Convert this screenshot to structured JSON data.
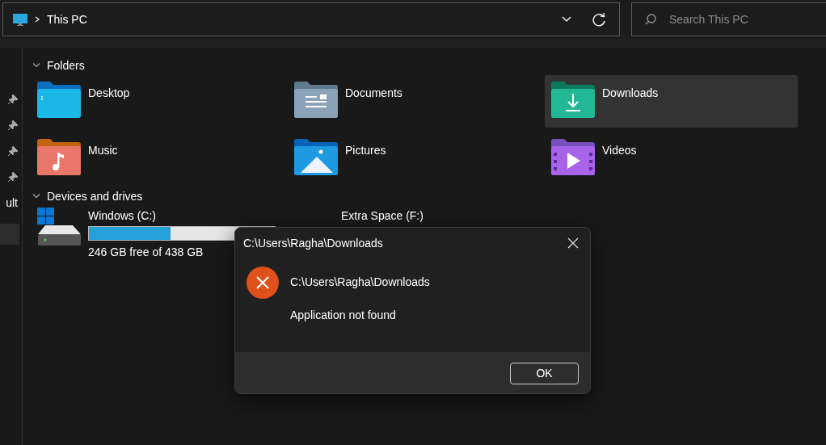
{
  "address_bar": {
    "location": "This PC"
  },
  "search": {
    "placeholder": "Search This PC"
  },
  "sidebar": {
    "items": [
      {
        "pinned": true,
        "selected": false
      },
      {
        "pinned": true,
        "selected": false
      },
      {
        "pinned": true,
        "selected": false
      },
      {
        "pinned": true,
        "selected": false
      },
      {
        "label": "ult",
        "pinned": false,
        "selected": false
      },
      {
        "pinned": false,
        "selected": true
      }
    ]
  },
  "folders": {
    "title": "Folders",
    "expanded": true,
    "items": [
      {
        "label": "Desktop",
        "kind": "desktop",
        "selected": false
      },
      {
        "label": "Documents",
        "kind": "documents",
        "selected": false
      },
      {
        "label": "Downloads",
        "kind": "downloads",
        "selected": true
      },
      {
        "label": "Music",
        "kind": "music",
        "selected": false
      },
      {
        "label": "Pictures",
        "kind": "pictures",
        "selected": false
      },
      {
        "label": "Videos",
        "kind": "videos",
        "selected": false
      }
    ]
  },
  "drives": {
    "title": "Devices and drives",
    "expanded": true,
    "items": [
      {
        "label": "Windows (C:)",
        "kind": "system",
        "level": 0.44,
        "free": "246 GB free of 438 GB"
      },
      {
        "label": "Extra Space (F:)"
      }
    ]
  },
  "dialog": {
    "title": "C:\\Users\\Ragha\\Downloads",
    "path": "C:\\Users\\Ragha\\Downloads",
    "message": "Application not found",
    "buttons": [
      "OK"
    ]
  }
}
